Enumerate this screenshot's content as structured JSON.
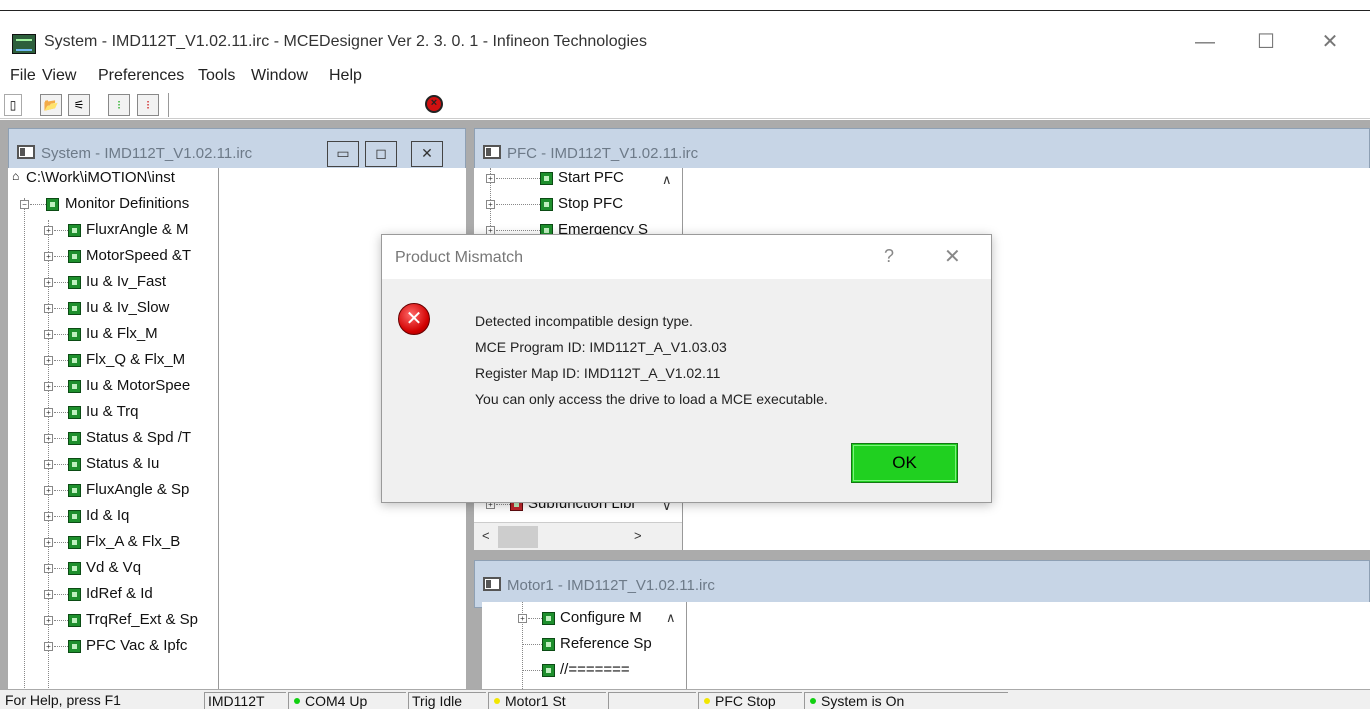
{
  "window": {
    "title": "System - IMD112T_V1.02.11.irc - MCEDesigner Ver 2. 3. 0. 1  - Infineon Technologies",
    "minimize": "—",
    "maximize": "☐",
    "close": "✕"
  },
  "menu": [
    "File",
    "View",
    "Preferences",
    "Tools",
    "Window",
    "Help"
  ],
  "toolbar": {
    "icons": [
      "new-icon",
      "open-icon",
      "connect-icon",
      "traffic-light-icon",
      "traffic-light-red-icon",
      "stop-icon"
    ]
  },
  "system_window": {
    "title": "System - IMD112T_V1.02.11.irc",
    "root": "C:\\Work\\iMOTION\\inst",
    "group": "Monitor Definitions",
    "items": [
      "FluxrAngle & M",
      "MotorSpeed &T",
      "Iu & Iv_Fast",
      "Iu & Iv_Slow",
      "Iu & Flx_M",
      "Flx_Q & Flx_M",
      "Iu & MotorSpee",
      "Iu & Trq",
      "Status & Spd /T",
      "Status & Iu",
      "FluxAngle & Sp",
      "Id & Iq",
      "Flx_A & Flx_B",
      "Vd & Vq",
      "IdRef & Id",
      "TrqRef_Ext & Sp",
      "PFC Vac & Ipfc"
    ]
  },
  "pfc_window": {
    "title": "PFC - IMD112T_V1.02.11.irc",
    "items": [
      "Start PFC",
      "Stop PFC",
      "Emergency S"
    ],
    "bottom_item": "Subfunction Libr"
  },
  "motor_window": {
    "title": "Motor1 - IMD112T_V1.02.11.irc",
    "items": [
      "Configure M",
      "Reference Sp",
      "//======="
    ]
  },
  "dialog": {
    "title": "Product Mismatch",
    "help": "?",
    "close": "✕",
    "lines": [
      "Detected incompatible design type.",
      "MCE Program ID: IMD112T_A_V1.03.03",
      "Register Map ID: IMD112T_A_V1.02.11",
      "You can only access the drive to load a MCE executable."
    ],
    "ok_label": "OK"
  },
  "statusbar": {
    "help": "For Help, press F1",
    "device": "IMD112T",
    "com": "COM4 Up",
    "trig": "Trig Idle",
    "motor": "Motor1 St",
    "pfc": "PFC Stop",
    "system": "System is On"
  },
  "colors": {
    "ok_button": "#20d020",
    "led_green": "#10d010",
    "led_yellow": "#f2e600",
    "child_title": "#c7d5e6"
  }
}
